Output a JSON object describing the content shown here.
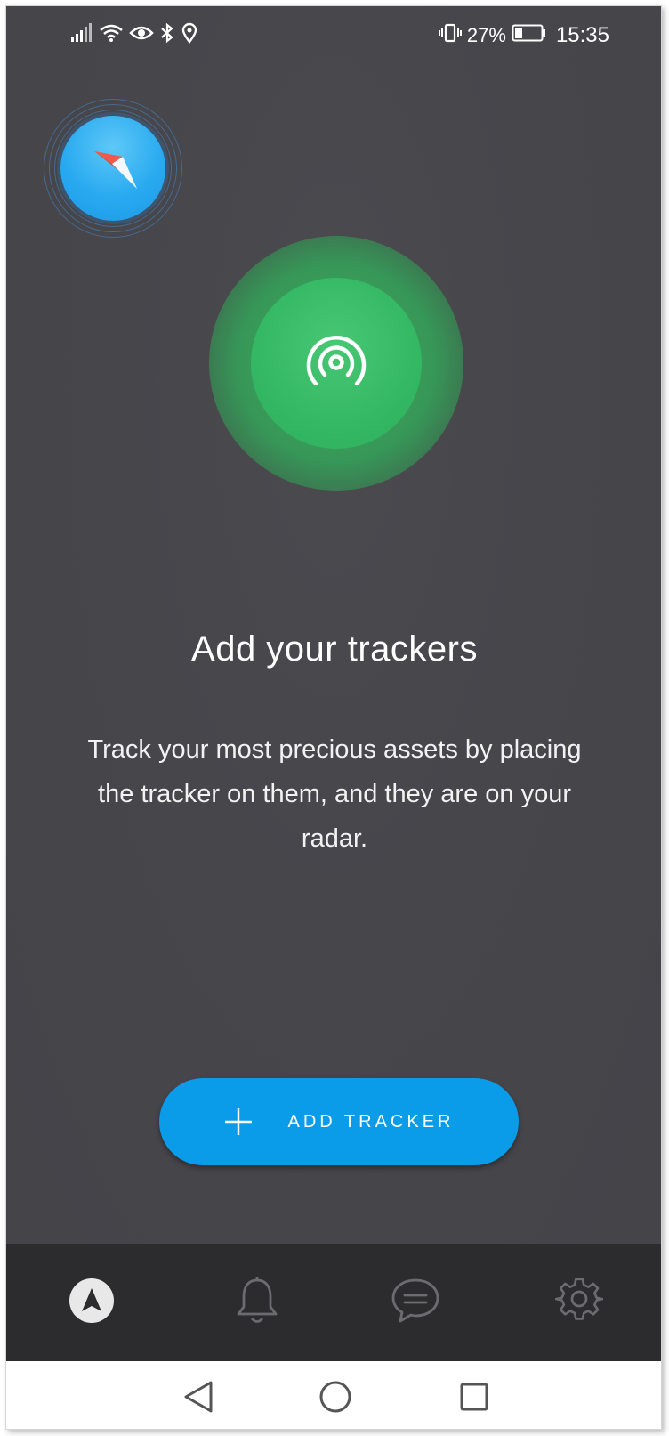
{
  "status_bar": {
    "icons_left": [
      "signal-icon",
      "wifi-icon",
      "eye-icon",
      "bluetooth-icon",
      "location-icon"
    ],
    "icons_right": [
      "vibrate-icon",
      "battery-icon"
    ],
    "battery_percent": "27%",
    "time": "15:35"
  },
  "hero": {
    "title": "Add your trackers",
    "description": "Track your most precious assets by placing the tracker on them, and they are on your radar."
  },
  "add_tracker_button": {
    "label": "ADD TRACKER",
    "icon": "plus-icon"
  },
  "tabbar": {
    "tabs": [
      {
        "name": "navigation",
        "icon": "navigation-arrow-icon",
        "active": true
      },
      {
        "name": "notifications",
        "icon": "bell-icon",
        "active": false
      },
      {
        "name": "messages",
        "icon": "chat-icon",
        "active": false
      },
      {
        "name": "settings",
        "icon": "gear-icon",
        "active": false
      }
    ]
  },
  "system_nav": [
    "back-icon",
    "home-icon",
    "recents-icon"
  ],
  "colors": {
    "background": "#46464b",
    "accent_blue": "#0a9be9",
    "radar_green": "#34b863",
    "tabbar": "#2c2c2f"
  }
}
